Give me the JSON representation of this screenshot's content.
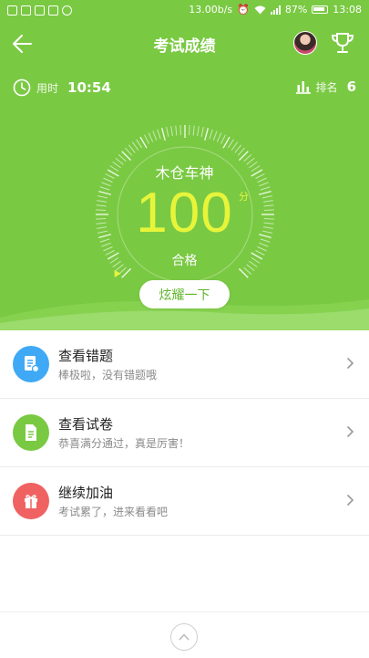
{
  "status_bar": {
    "network_speed": "13.00b/s",
    "battery": "87%",
    "time": "13:08"
  },
  "nav": {
    "title": "考试成绩",
    "back_icon": "arrow-left-icon",
    "trophy_icon": "trophy-icon"
  },
  "stats": {
    "time_label": "用时",
    "time_value": "10:54",
    "rank_label": "排名",
    "rank_value": "6"
  },
  "gauge": {
    "title": "木仓车神",
    "score": "100",
    "unit": "分",
    "status": "合格",
    "level_fraction": 1.0
  },
  "share_button": "炫耀一下",
  "list": [
    {
      "title": "查看错题",
      "subtitle": "棒极啦，没有错题哦",
      "icon": "wrong-questions-icon",
      "color": "#3fa9f5"
    },
    {
      "title": "查看试卷",
      "subtitle": "恭喜满分通过，真是厉害！",
      "icon": "paper-icon",
      "color": "#7ac943"
    },
    {
      "title": "继续加油",
      "subtitle": "考试累了，进来看看吧",
      "icon": "gift-icon",
      "color": "#f06262"
    }
  ],
  "colors": {
    "header_green": "#7ac943",
    "score_yellow": "#e7f53a"
  }
}
